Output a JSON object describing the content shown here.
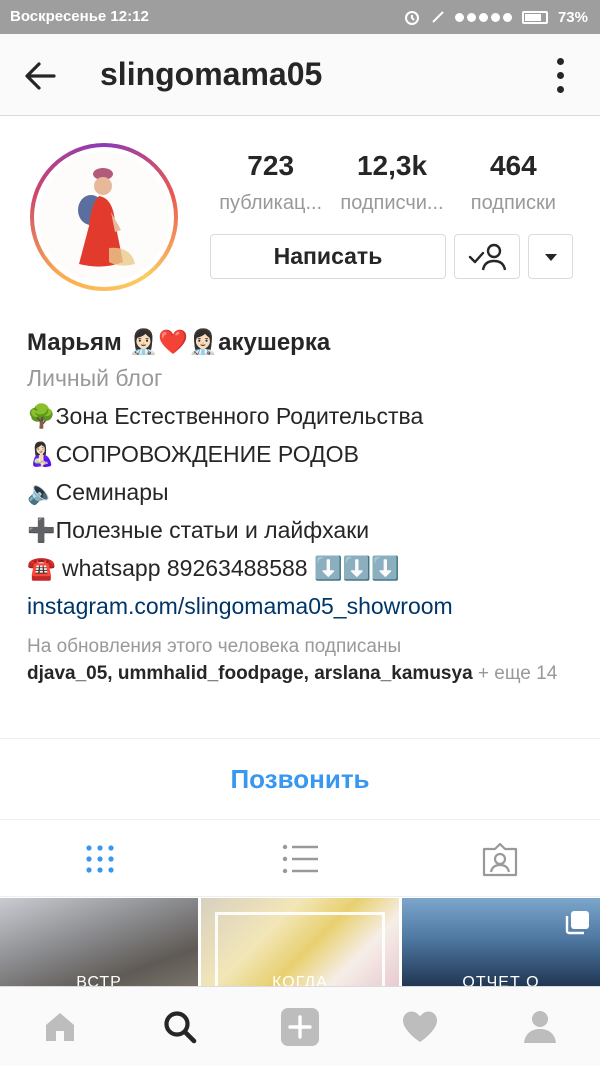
{
  "status_bar": {
    "time": "Воскресенье 12:12",
    "battery": "73%"
  },
  "header": {
    "username": "slingomama05"
  },
  "stats": [
    {
      "value": "723",
      "label": "публикац..."
    },
    {
      "value": "12,3k",
      "label": "подписчи..."
    },
    {
      "value": "464",
      "label": "подписки"
    }
  ],
  "actions": {
    "message_label": "Написать"
  },
  "bio": {
    "name": "Марьям 👩🏻‍⚕️❤️👩🏻‍⚕️акушерка",
    "category": "Личный блог",
    "lines": [
      "🌳Зона Естественного Родительства",
      "🤱🏻СОПРОВОЖДЕНИЕ РОДОВ",
      "🔈Семинары",
      "➕Полезные статьи и лайфхаки",
      "☎️ whatsapp 89263488588 ⬇️⬇️⬇️"
    ],
    "link": "instagram.com/slingomama05_showroom",
    "followed_by_label": "На обновления этого человека подписаны",
    "followed_users": "djava_05, ummhalid_foodpage, arslana_kamusya",
    "followed_more": " + еще 14"
  },
  "call_label": "Позвонить",
  "grid": [
    {
      "caption": "ВСТР"
    },
    {
      "caption": "КОГДА"
    },
    {
      "caption": "ОТЧЕТ О"
    }
  ],
  "colors": {
    "accent": "#3897f0",
    "link": "#003569",
    "text": "#262626",
    "muted": "#999999",
    "status_bar": "#9e9e9e"
  },
  "icons": {
    "back": "arrow-left-icon",
    "more": "more-vertical-icon",
    "follow": "following-check-icon",
    "dropdown": "chevron-down-icon",
    "grid_view": "grid-icon",
    "list_view": "list-icon",
    "tagged": "tagged-photos-icon",
    "home": "home-icon",
    "search": "search-icon",
    "add": "add-post-icon",
    "activity": "heart-icon",
    "profile": "profile-icon"
  }
}
